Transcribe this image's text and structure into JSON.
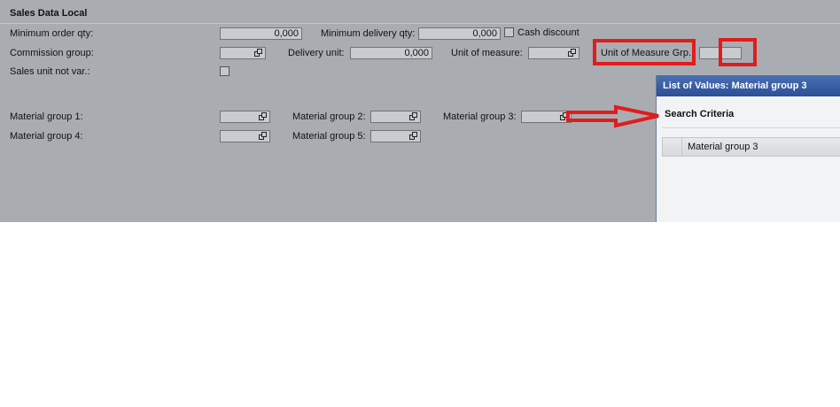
{
  "section": {
    "title": "Sales Data Local"
  },
  "labels": {
    "min_order_qty": "Minimum order qty:",
    "min_delivery_qty": "Minimum delivery qty:",
    "cash_discount": "Cash discount",
    "commission_group": "Commission group:",
    "delivery_unit": "Delivery unit:",
    "unit_of_measure": "Unit of measure:",
    "uom_group": "Unit of Measure Grp.:",
    "sales_unit_not_var": "Sales unit not var.:",
    "mg1": "Material group 1:",
    "mg2": "Material group 2:",
    "mg3": "Material group 3:",
    "mg4": "Material group 4:",
    "mg5": "Material group 5:"
  },
  "values": {
    "min_order_qty": "0,000",
    "min_delivery_qty": "0,000",
    "delivery_unit": "0,000"
  },
  "popup": {
    "title": "List of Values: Material group 3",
    "search_criteria": "Search Criteria",
    "criteria_row": "Material group 3"
  },
  "colors": {
    "panel_bg": "#a9adb2",
    "highlight_red": "#e11c1c",
    "popup_title_bg": "#2c4f96"
  }
}
